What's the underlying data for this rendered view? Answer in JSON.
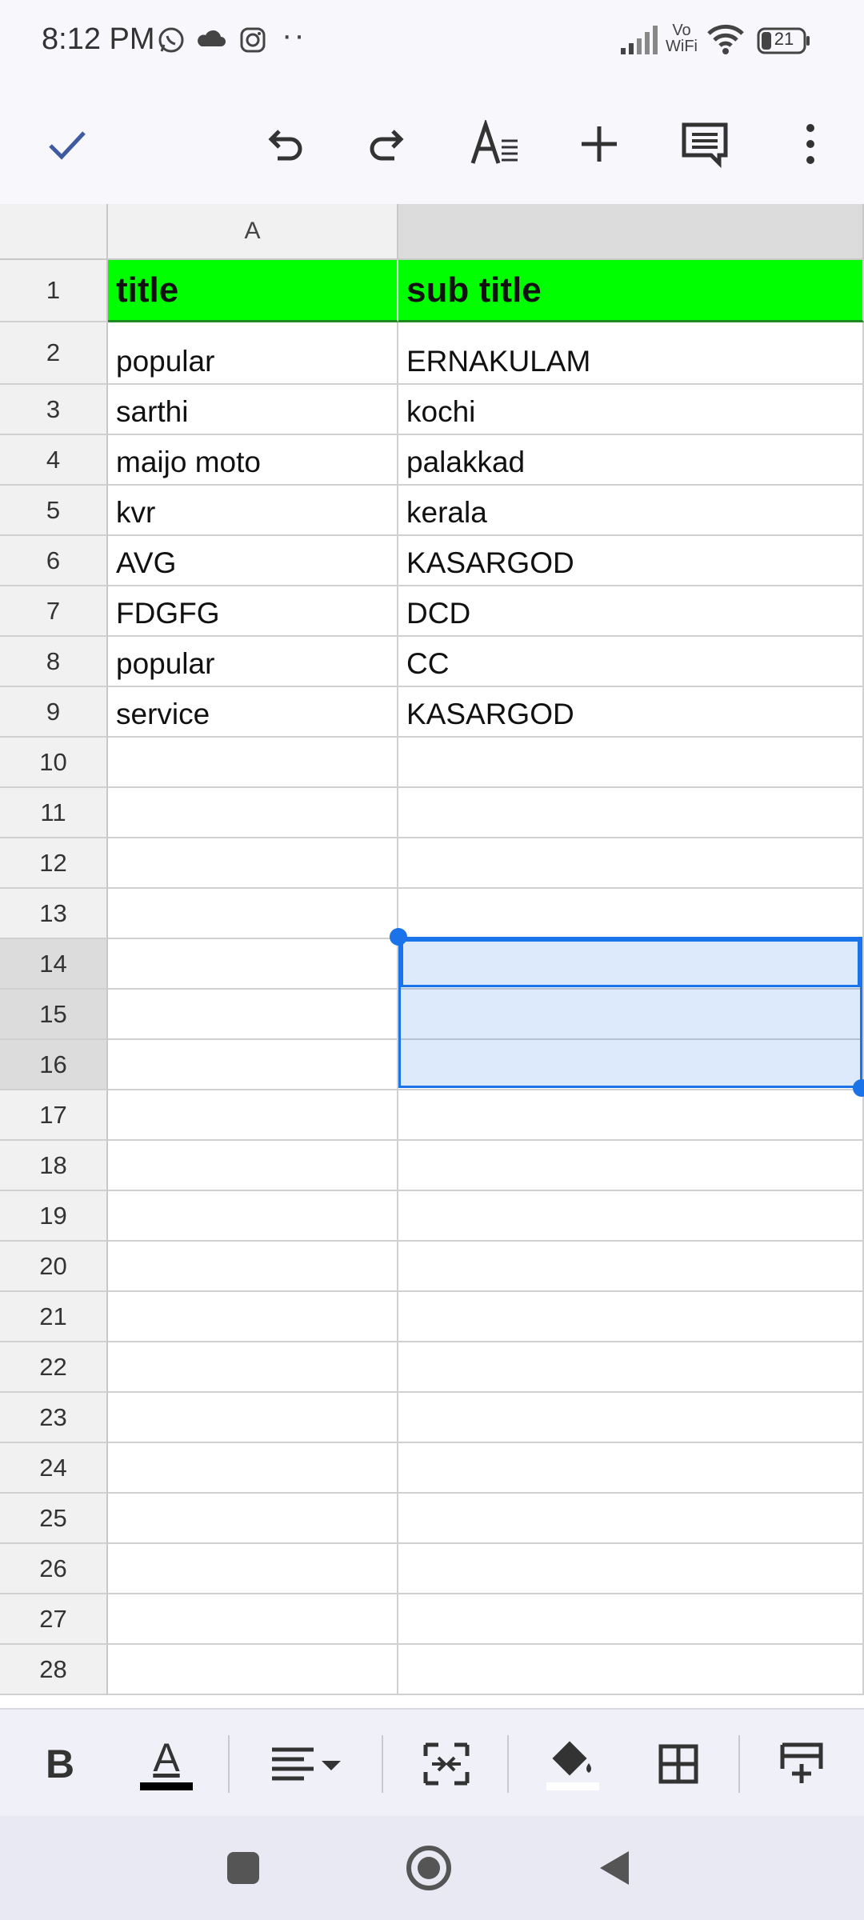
{
  "status_bar": {
    "time": "8:12 PM",
    "battery": "21",
    "network_label_top": "Vo",
    "network_label_bottom": "WiFi"
  },
  "toolbar": {
    "icons": [
      "check-icon",
      "undo-icon",
      "redo-icon",
      "text-format-icon",
      "add-icon",
      "comment-icon",
      "more-vert-icon"
    ]
  },
  "sheet": {
    "column_headers": [
      "A",
      ""
    ],
    "row_numbers": [
      "1",
      "2",
      "3",
      "4",
      "5",
      "6",
      "7",
      "8",
      "9",
      "10",
      "11",
      "12",
      "13",
      "14",
      "15",
      "16",
      "17",
      "18",
      "19",
      "20",
      "21",
      "22",
      "23",
      "24",
      "25",
      "26",
      "27",
      "28"
    ],
    "rows": [
      [
        "title",
        "sub title"
      ],
      [
        "popular",
        "ERNAKULAM"
      ],
      [
        "sarthi",
        "kochi"
      ],
      [
        "maijo moto",
        "palakkad"
      ],
      [
        "kvr",
        "kerala"
      ],
      [
        "AVG",
        "KASARGOD"
      ],
      [
        "FDGFG",
        "DCD"
      ],
      [
        "popular",
        "CC"
      ],
      [
        "service",
        "KASARGOD"
      ]
    ],
    "header_fill": "#00ff00",
    "selection_color": "#1a73e8"
  },
  "format_bar": {
    "icons": [
      "bold-icon",
      "text-color-icon",
      "align-icon",
      "merge-cells-icon",
      "fill-color-icon",
      "borders-icon",
      "insert-icon"
    ],
    "bold_label": "B",
    "text_color_label": "A"
  }
}
